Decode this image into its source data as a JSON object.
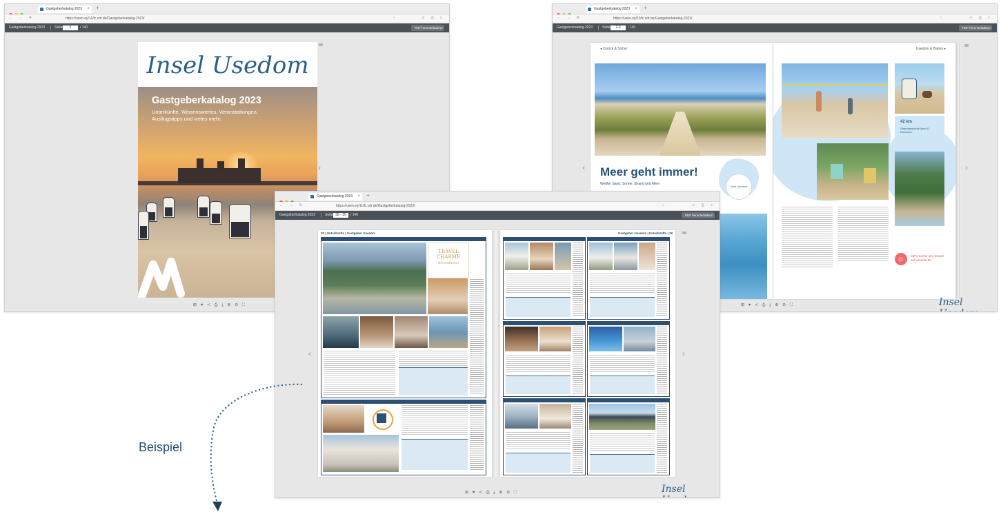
{
  "colors": {
    "brand_blue": "#2b5f86",
    "listing_blue": "#2d4f72",
    "app_bar": "#4b5257",
    "beispiel_text": "#24506f",
    "dotted_arrow": "#2e6f93"
  },
  "browser": {
    "tab_title": "Gastgeberkatalog 2023",
    "new_tab": "+",
    "close": "×",
    "url": "https://usen.ey/11/fc.cdr.de/Gastgeberkatalog-2023/"
  },
  "viewer": {
    "app_title": "Gastgeberkatalog 2023",
    "page_label": "Seiten",
    "win1_page": "1",
    "win2_page": "2-3",
    "win3_page": "38 - 39",
    "total": "/ 140",
    "pdf_button": "PDF herunterladen",
    "search_icon": "⌕",
    "toolbar_icons": "⊞ ♥  ≺ ⎙ ⤓  ⊕ ⊖ ⛶",
    "prev_arrow": "‹",
    "next_arrow": "›"
  },
  "cover": {
    "logo": "Insel Usedom",
    "title": "Gastgeberkatalog 2023",
    "subtitle_line1": "Unterkünfte, Wissenswertes, Veranstaltungen,",
    "subtitle_line2": "Ausflugstipps und vieles mehr."
  },
  "spread_beach": {
    "left_top_left": "◂ Zurück & Sicher",
    "left_top_right": "Usedom & Baden ▸",
    "headline": "Meer geht immer!",
    "subline": "Weißer Sand, Sonne, Strand und Meer",
    "badge": "Insel Usedom",
    "sign_title": "42 km",
    "sign_text": "Strandabschnitt über 42 Kilometer",
    "sun_text": "Mehr Sonne und Strand auf usedom.de",
    "footer_logo": "Insel Usedom"
  },
  "spread_listings": {
    "left_header": "38 | Unterkünfte | Gastgeber Usedom",
    "right_header": "Gastgeber Usedom | Unterkünfte | 39",
    "hotel_name": "TRAVEL CHARME",
    "hotel_sub": "Strandhotel",
    "footer_logo": "Insel Usedom"
  },
  "annotation": {
    "label": "Beispiel"
  }
}
